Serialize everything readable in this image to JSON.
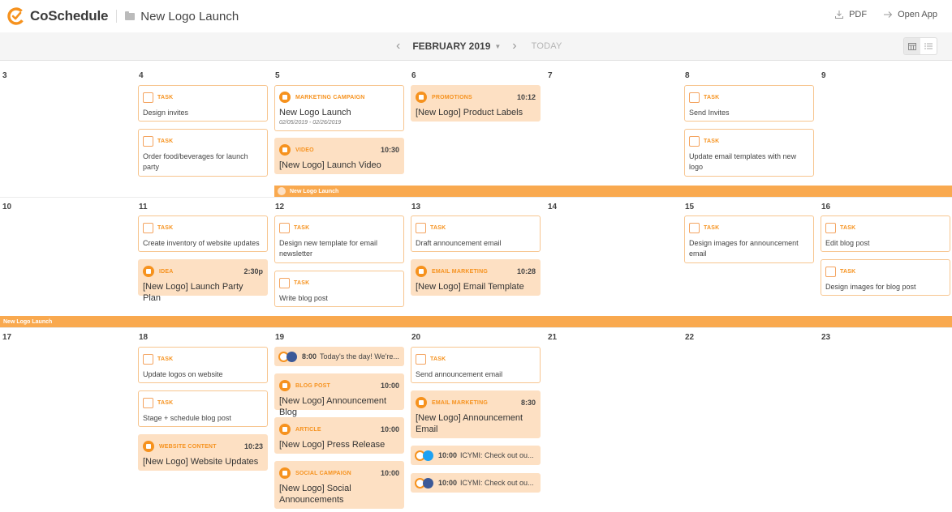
{
  "app": {
    "name": "CoSchedule",
    "project": "New Logo Launch"
  },
  "actions": {
    "pdf": "PDF",
    "open_app": "Open App"
  },
  "nav": {
    "month": "FEBRUARY 2019",
    "today": "TODAY"
  },
  "colors": {
    "accent": "#f6921e",
    "card_fill": "#fde0c3",
    "band": "#f9a94f",
    "twitter": "#1da1f2",
    "facebook": "#3b5998"
  },
  "days": [
    "3",
    "4",
    "5",
    "6",
    "7",
    "8",
    "9",
    "10",
    "11",
    "12",
    "13",
    "14",
    "15",
    "16",
    "17",
    "18",
    "19",
    "20",
    "21",
    "22",
    "23"
  ],
  "bands": [
    "New Logo Launch",
    "New Logo Launch"
  ],
  "cards": {
    "d4a": {
      "type": "TASK",
      "title": "Design invites"
    },
    "d4b": {
      "type": "TASK",
      "title": "Order food/beverages for launch party"
    },
    "d5a": {
      "type": "MARKETING CAMPAIGN",
      "title": "New Logo Launch",
      "sub": "02/05/2019 - 02/26/2019"
    },
    "d5b": {
      "type": "VIDEO",
      "time": "10:30",
      "title": "[New Logo] Launch Video"
    },
    "d6a": {
      "type": "PROMOTIONS",
      "time": "10:12",
      "title": "[New Logo] Product Labels"
    },
    "d8a": {
      "type": "TASK",
      "title": "Send Invites"
    },
    "d8b": {
      "type": "TASK",
      "title": "Update email templates with new logo"
    },
    "d11a": {
      "type": "TASK",
      "title": "Create inventory of website updates"
    },
    "d11b": {
      "type": "IDEA",
      "time": "2:30p",
      "title": "[New Logo] Launch Party Plan"
    },
    "d12a": {
      "type": "TASK",
      "title": "Design new template for email newsletter"
    },
    "d12b": {
      "type": "TASK",
      "title": "Write blog post"
    },
    "d13a": {
      "type": "TASK",
      "title": "Draft announcement email"
    },
    "d13b": {
      "type": "EMAIL MARKETING",
      "time": "10:28",
      "title": "[New Logo] Email Template"
    },
    "d15a": {
      "type": "TASK",
      "title": "Design images for announcement email"
    },
    "d16a": {
      "type": "TASK",
      "title": "Edit blog post"
    },
    "d16b": {
      "type": "TASK",
      "title": "Design images for blog post"
    },
    "d18a": {
      "type": "TASK",
      "title": "Update logos on website"
    },
    "d18b": {
      "type": "TASK",
      "title": "Stage + schedule blog post"
    },
    "d18c": {
      "type": "WEBSITE CONTENT",
      "time": "10:23",
      "title": "[New Logo] Website Updates"
    },
    "d19b": {
      "type": "BLOG POST",
      "time": "10:00",
      "title": "[New Logo] Announcement Blog"
    },
    "d19c": {
      "type": "ARTICLE",
      "time": "10:00",
      "title": "[New Logo] Press Release"
    },
    "d19d": {
      "type": "SOCIAL CAMPAIGN",
      "time": "10:00",
      "title": "[New Logo] Social Announcements"
    },
    "d20a": {
      "type": "TASK",
      "title": "Send announcement email"
    },
    "d20b": {
      "type": "EMAIL MARKETING",
      "time": "8:30",
      "title": "[New Logo] Announcement Email"
    }
  },
  "social": {
    "s19": {
      "time": "8:00",
      "text": "Today's the day! We're..."
    },
    "s20a": {
      "time": "10:00",
      "text": "ICYMI: Check out ou..."
    },
    "s20b": {
      "time": "10:00",
      "text": "ICYMI: Check out ou..."
    }
  }
}
